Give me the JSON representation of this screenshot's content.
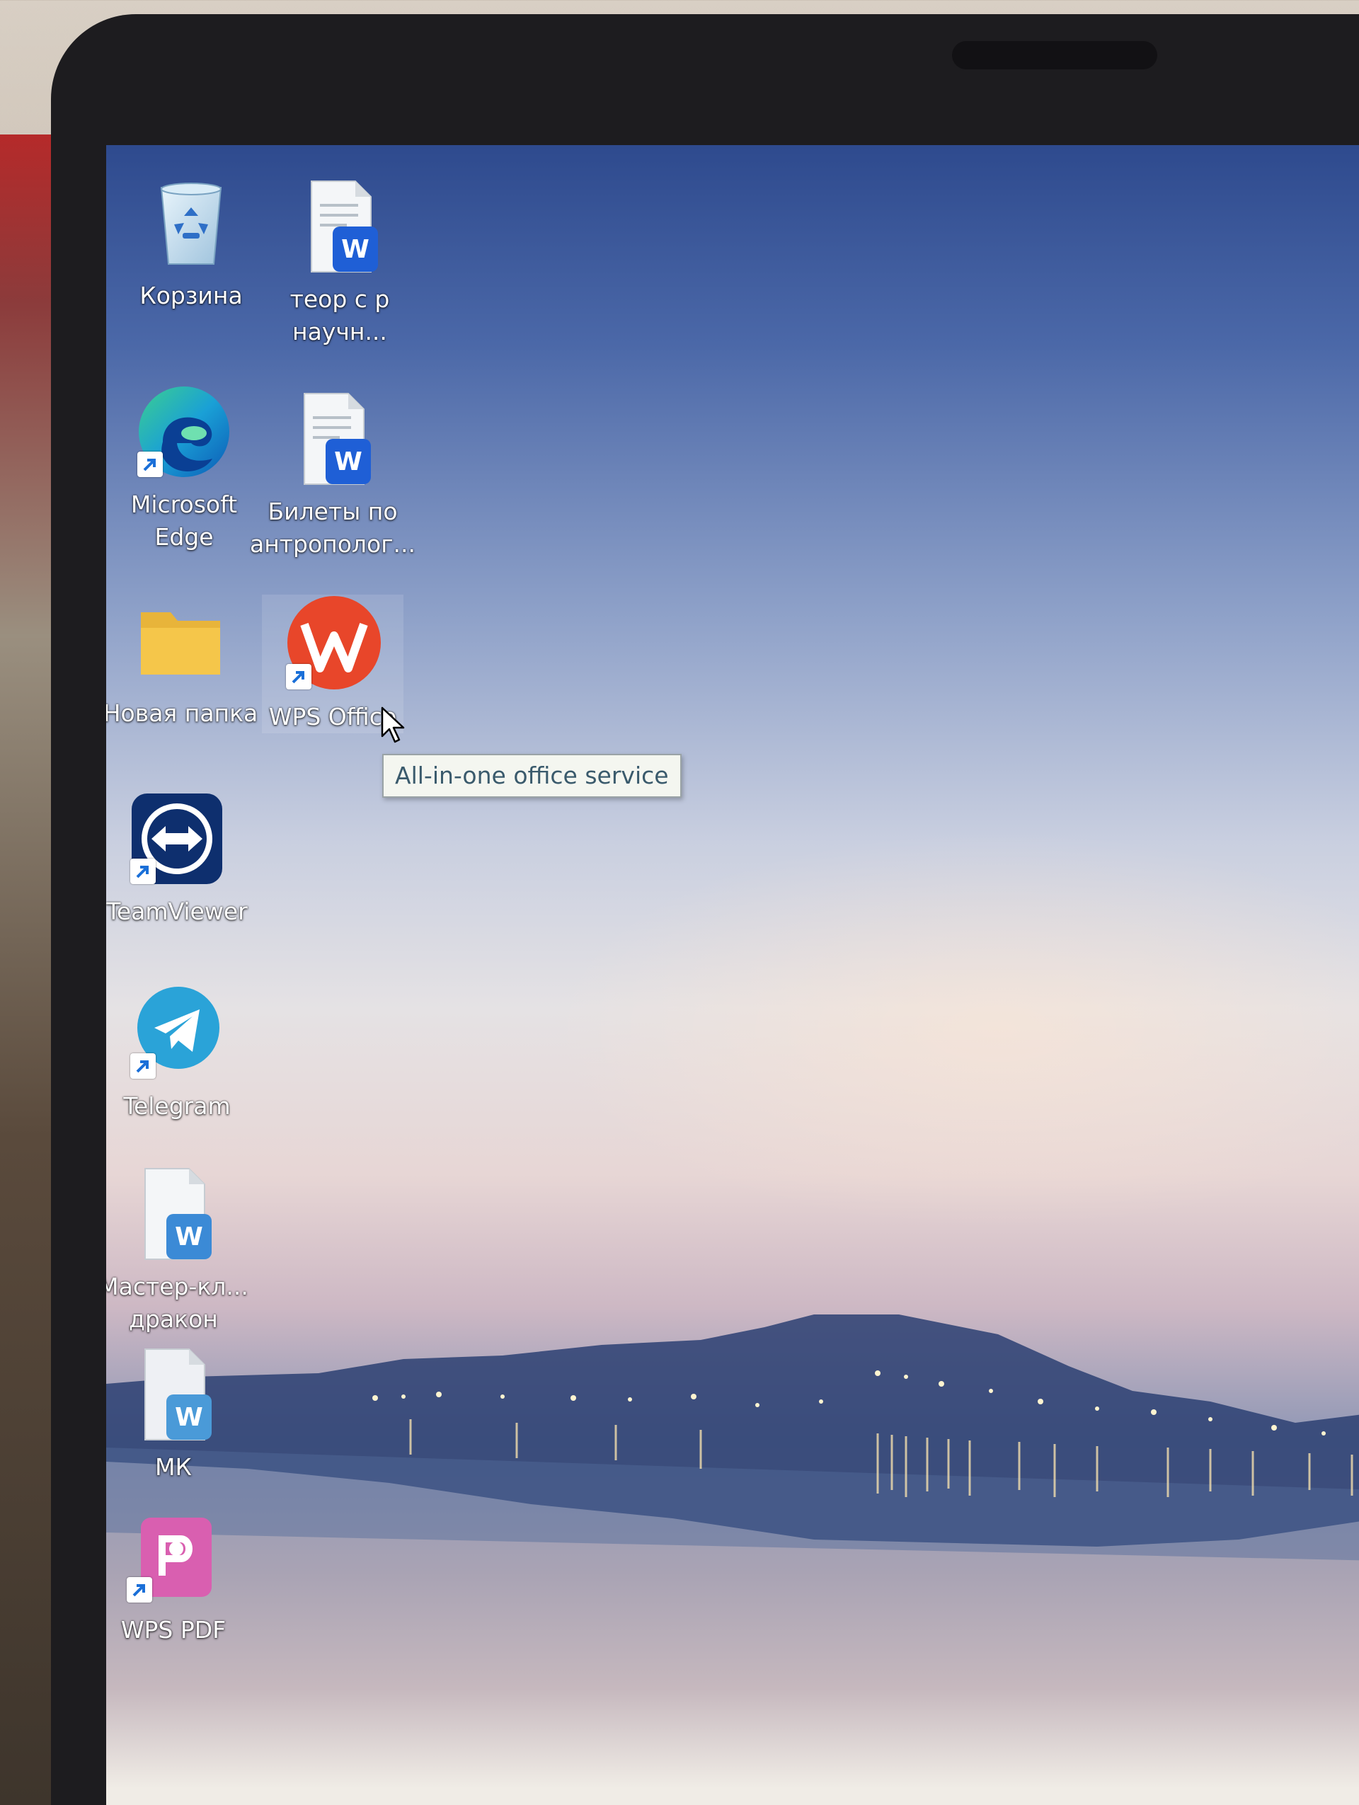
{
  "desktop": {
    "icons": [
      {
        "label_lines": [
          "Корзина"
        ],
        "icon": "recycle-bin-icon"
      },
      {
        "label_lines": [
          "теор с р",
          "научн..."
        ],
        "icon": "word-document-icon"
      },
      {
        "label_lines": [
          "Microsoft",
          "Edge"
        ],
        "icon": "edge-icon"
      },
      {
        "label_lines": [
          "Билеты по",
          "антрополог..."
        ],
        "icon": "word-document-icon"
      },
      {
        "label_lines": [
          "Новая папка"
        ],
        "icon": "folder-icon"
      },
      {
        "label_lines": [
          "WPS Office"
        ],
        "icon": "wps-office-icon"
      },
      {
        "label_lines": [
          "TeamViewer"
        ],
        "icon": "teamviewer-icon"
      },
      {
        "label_lines": [
          "Telegram"
        ],
        "icon": "telegram-icon"
      },
      {
        "label_lines": [
          "Мастер-кл...",
          "дракон"
        ],
        "icon": "word-document-icon"
      },
      {
        "label_lines": [
          "МК"
        ],
        "icon": "word-document-icon"
      },
      {
        "label_lines": [
          "WPS PDF"
        ],
        "icon": "wps-pdf-icon"
      }
    ],
    "tooltip": "All-in-one office service"
  },
  "colors": {
    "word_blue": "#1f5fd6",
    "wps_red": "#e8462a",
    "teamviewer_blue": "#0e2f6e",
    "telegram_blue": "#2aa3d8",
    "folder_yellow": "#f5c64a",
    "wps_pdf_pink": "#d95fb0"
  }
}
